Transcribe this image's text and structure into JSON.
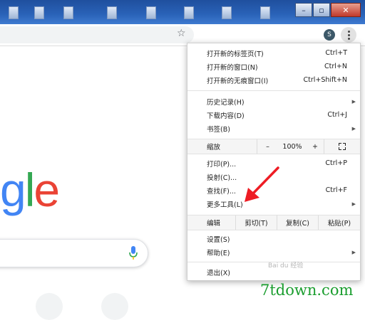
{
  "window": {
    "minimize_glyph": "–",
    "maximize_glyph": "▫",
    "close_glyph": "✕"
  },
  "toolbar": {
    "bookmark_icon": "star-icon",
    "avatar_letter": "S",
    "menu_icon": "three-dot-vertical-icon"
  },
  "google": {
    "logo_letters": [
      {
        "ch": "g",
        "color": "#4285F4"
      },
      {
        "ch": "l",
        "color": "#34A853"
      },
      {
        "ch": "e",
        "color": "#EA4335"
      }
    ],
    "mic_colors": [
      "#4285F4",
      "#34A853",
      "#FBBC05",
      "#EA4335"
    ]
  },
  "menu": {
    "group1": [
      {
        "label": "打开新的标签页(T)",
        "shortcut": "Ctrl+T"
      },
      {
        "label": "打开新的窗口(N)",
        "shortcut": "Ctrl+N"
      },
      {
        "label": "打开新的无痕窗口(I)",
        "shortcut": "Ctrl+Shift+N"
      }
    ],
    "group2": [
      {
        "label": "历史记录(H)",
        "has_submenu": true
      },
      {
        "label": "下载内容(D)",
        "shortcut": "Ctrl+J"
      },
      {
        "label": "书签(B)",
        "has_submenu": true
      }
    ],
    "zoom": {
      "label": "缩放",
      "minus": "–",
      "value": "100%",
      "plus": "+",
      "fullscreen_icon": "fullscreen-icon"
    },
    "group3": [
      {
        "label": "打印(P)...",
        "shortcut": "Ctrl+P"
      },
      {
        "label": "投射(C)..."
      },
      {
        "label": "查找(F)...",
        "shortcut": "Ctrl+F"
      },
      {
        "label": "更多工具(L)",
        "has_submenu": true
      }
    ],
    "edit": {
      "label": "编辑",
      "cut": "剪切(T)",
      "copy": "复制(C)",
      "paste": "粘贴(P)"
    },
    "group4": [
      {
        "label": "设置(S)"
      },
      {
        "label": "帮助(E)",
        "has_submenu": true
      }
    ],
    "exit": {
      "label": "退出(X)"
    }
  },
  "annotation": {
    "arrow_color": "#ee1c24"
  },
  "watermarks": {
    "baidu": "Bai du 经验",
    "site": "7tdown.com"
  },
  "colors": {
    "site_watermark": "#1a9d2e",
    "titlebar": "#2a63b8"
  }
}
